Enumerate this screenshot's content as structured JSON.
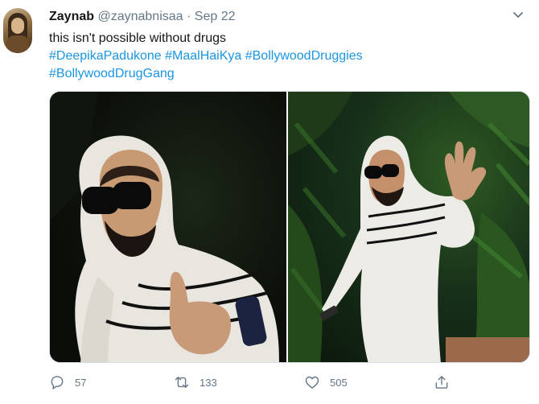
{
  "tweet": {
    "display_name": "Zaynab",
    "handle": "@zaynabnisaa",
    "separator": "·",
    "date": "Sep 22",
    "text": "this isn't possible without drugs",
    "hashtags_line1": [
      "#DeepikaPadukone",
      "#MaalHaiKya",
      "#BollywoodDruggies"
    ],
    "hashtags_line2": [
      "#BollywoodDrugGang"
    ]
  },
  "actions": {
    "replies": "57",
    "retweets": "133",
    "likes": "505"
  },
  "icons": {
    "more": "chevron-down-icon",
    "reply": "reply-icon",
    "retweet": "retweet-icon",
    "like": "heart-icon",
    "share": "share-icon"
  },
  "colors": {
    "link": "#1b95e0",
    "secondary_text": "#657786",
    "primary_text": "#14171a"
  }
}
